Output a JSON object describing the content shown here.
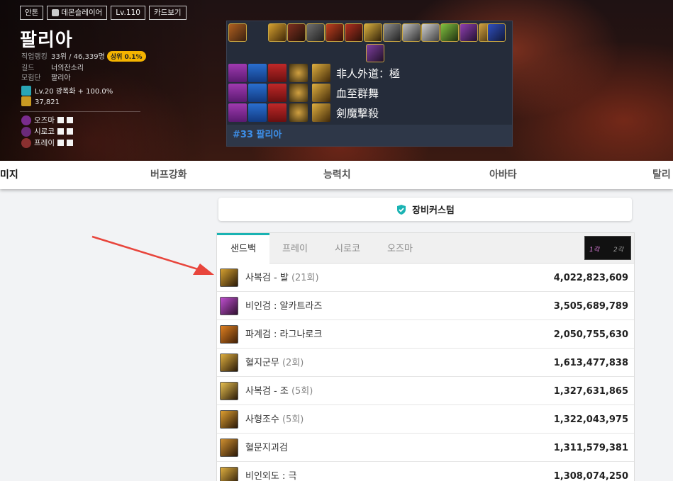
{
  "character": {
    "tags": [
      "안톤",
      "데몬슬레이어",
      "Lv.110",
      "카드보기"
    ],
    "name": "팔리아",
    "rank_label": "직업랭킹",
    "rank_value": "33위 / 46,339명",
    "rank_badge": "상위 0.1%",
    "guild_label": "길드",
    "guild_value": "너의잔소리",
    "adventure_label": "모험단",
    "adventure_value": "팔리아",
    "awaken_text": "Lv.20 광폭화 + 100.0%",
    "fame": "37,821",
    "raids": [
      {
        "name": "오즈마",
        "icon": "ozma-icon"
      },
      {
        "name": "시로코",
        "icon": "siroco-icon"
      },
      {
        "name": "프레이",
        "icon": "prey-icon"
      }
    ]
  },
  "card_panel": {
    "engravings": [
      "非人外道：極",
      "血至群舞",
      "剣魔撃殺"
    ],
    "footer": "#33 팔리아"
  },
  "nav_tabs": [
    "미지",
    "버프강화",
    "능력치",
    "아바타",
    "탈리"
  ],
  "custom_button": {
    "label": "장비커스텀",
    "icon": "shield-check-icon"
  },
  "damage_panel": {
    "tabs": [
      "샌드백",
      "프레이",
      "시로코",
      "오즈마"
    ],
    "active_tab": "샌드백",
    "awakening_labels": [
      "1각",
      "2각"
    ],
    "rows": [
      {
        "name": "사복검 - 발",
        "count": "(21회)",
        "value": "4,022,823,609"
      },
      {
        "name": "비인검 : 알카트라즈",
        "count": "",
        "value": "3,505,689,789"
      },
      {
        "name": "파계검 : 라그나로크",
        "count": "",
        "value": "2,050,755,630"
      },
      {
        "name": "혈지군무",
        "count": "(2회)",
        "value": "1,613,477,838"
      },
      {
        "name": "사복검 - 조",
        "count": "(5회)",
        "value": "1,327,631,865"
      },
      {
        "name": "사형조수",
        "count": "(5회)",
        "value": "1,322,043,975"
      },
      {
        "name": "혈문지괴검",
        "count": "",
        "value": "1,311,579,381"
      },
      {
        "name": "비인외도 : 극",
        "count": "",
        "value": "1,308,074,250"
      }
    ]
  },
  "colors": {
    "accent": "#1ab3b3",
    "badge": "#f5b400",
    "footer_text": "#3d8fe8",
    "arrow": "#e8453c"
  }
}
